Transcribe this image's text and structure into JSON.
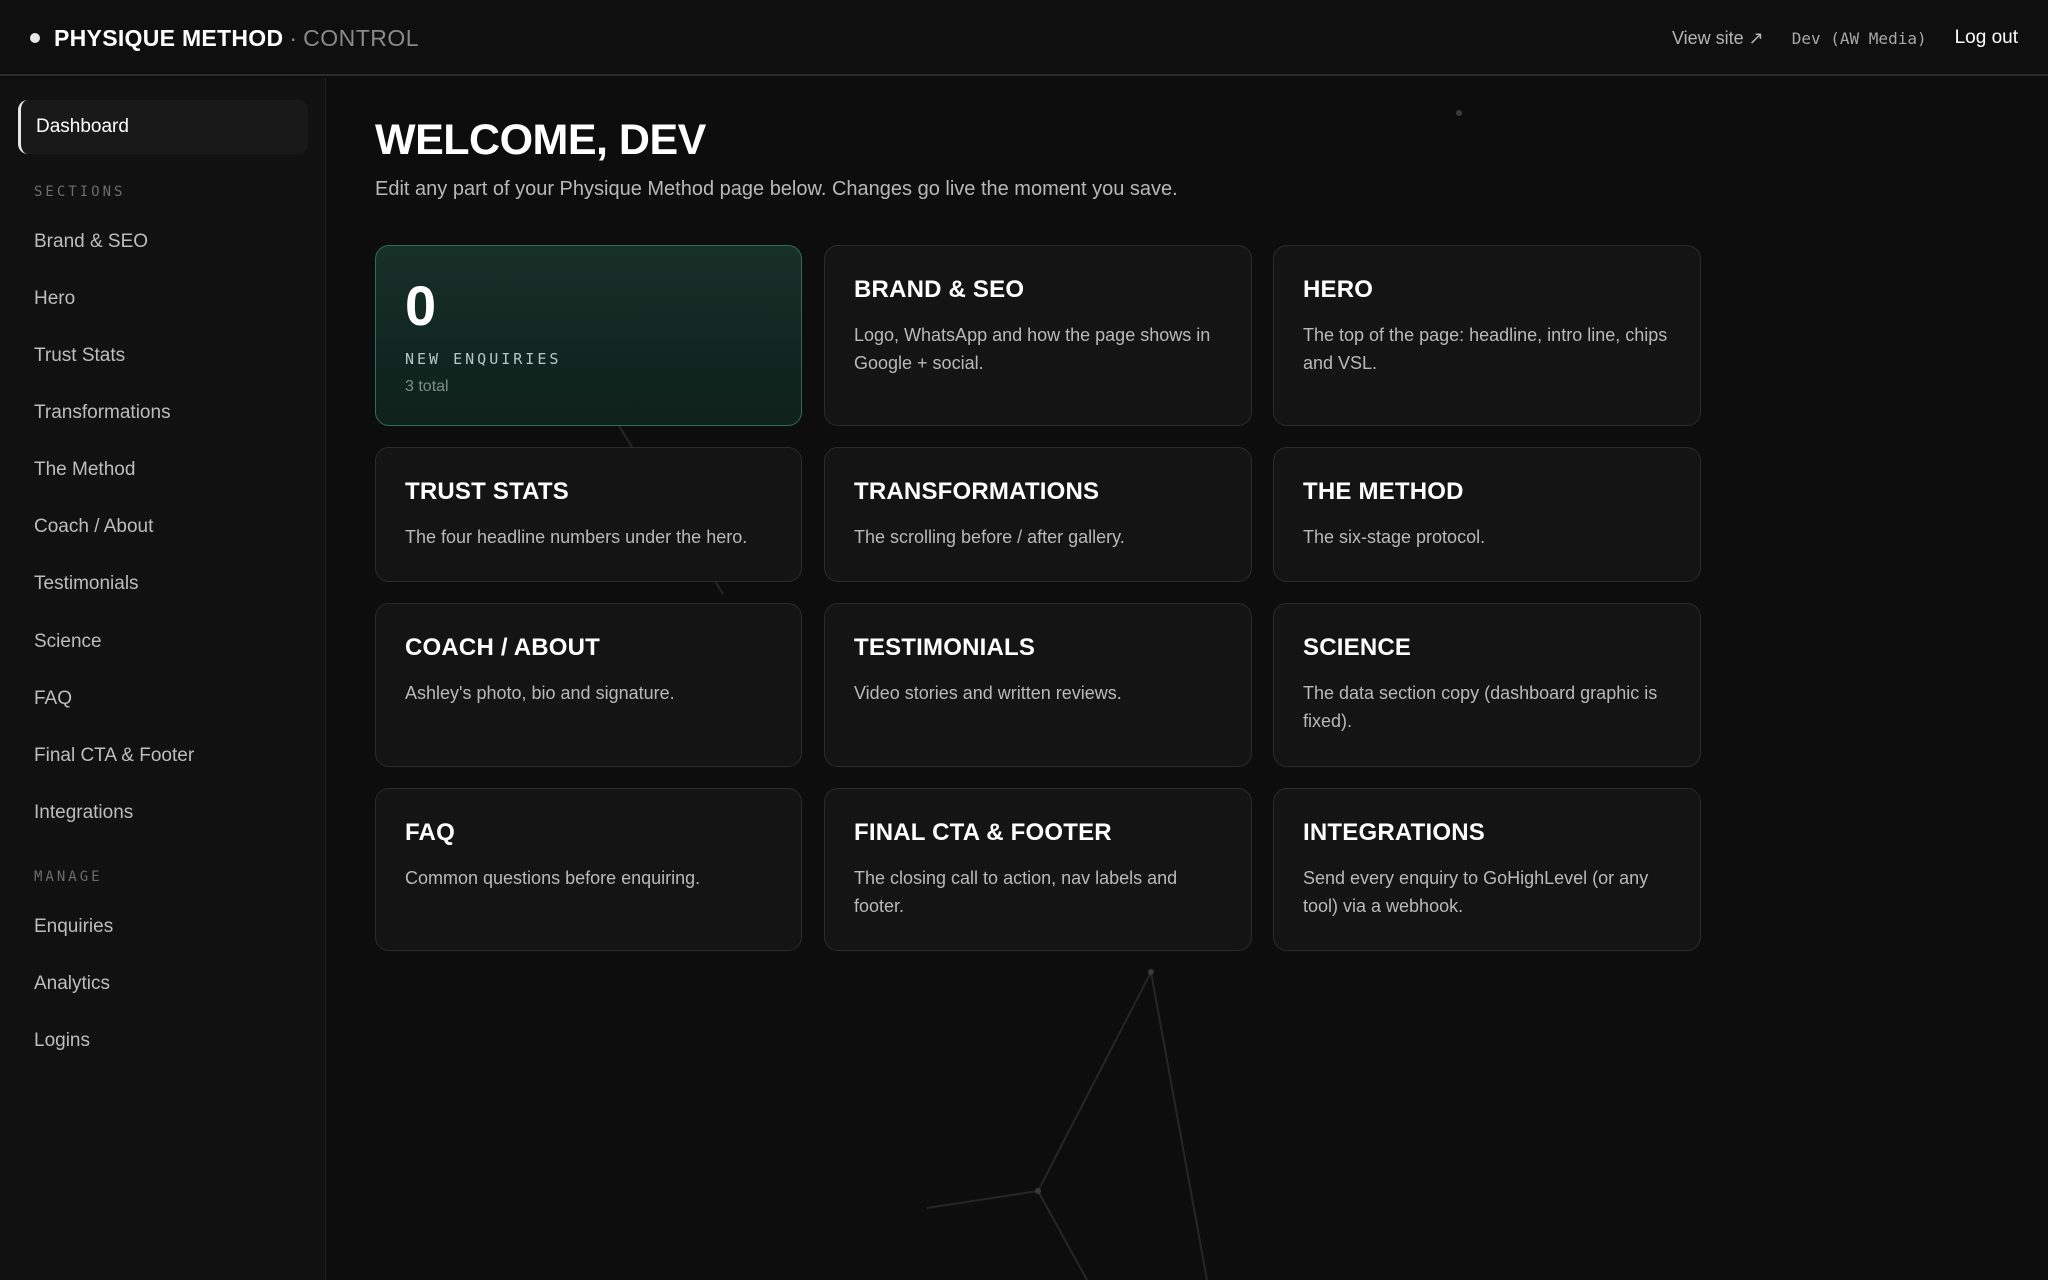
{
  "app": {
    "brand_name": "PHYSIQUE METHOD",
    "brand_sep": "·",
    "brand_sub": "CONTROL"
  },
  "topnav": {
    "view_site": "View site ↗",
    "user": "Dev (AW Media)",
    "logout": "Log out"
  },
  "sidebar": {
    "active": "Dashboard",
    "sections_heading": "SECTIONS",
    "sections": [
      "Brand & SEO",
      "Hero",
      "Trust Stats",
      "Transformations",
      "The Method",
      "Coach / About",
      "Testimonials",
      "Science",
      "FAQ",
      "Final CTA & Footer",
      "Integrations"
    ],
    "manage_heading": "MANAGE",
    "manage": [
      "Enquiries",
      "Analytics",
      "Logins"
    ]
  },
  "main": {
    "title": "WELCOME, DEV",
    "subtitle": "Edit any part of your Physique Method page below. Changes go live the moment you save.",
    "stat": {
      "value": "0",
      "label": "NEW ENQUIRIES",
      "total": "3 total"
    },
    "cards": [
      {
        "title": "BRAND & SEO",
        "desc": "Logo, WhatsApp and how the page shows in Google + social."
      },
      {
        "title": "HERO",
        "desc": "The top of the page: headline, intro line, chips and VSL."
      },
      {
        "title": "TRUST STATS",
        "desc": "The four headline numbers under the hero."
      },
      {
        "title": "TRANSFORMATIONS",
        "desc": "The scrolling before / after gallery."
      },
      {
        "title": "THE METHOD",
        "desc": "The six-stage protocol."
      },
      {
        "title": "COACH / ABOUT",
        "desc": "Ashley's photo, bio and signature."
      },
      {
        "title": "TESTIMONIALS",
        "desc": "Video stories and written reviews."
      },
      {
        "title": "SCIENCE",
        "desc": "The data section copy (dashboard graphic is fixed)."
      },
      {
        "title": "FAQ",
        "desc": "Common questions before enquiring."
      },
      {
        "title": "FINAL CTA & FOOTER",
        "desc": "The closing call to action, nav labels and footer."
      },
      {
        "title": "INTEGRATIONS",
        "desc": "Send every enquiry to GoHighLevel (or any tool) via a webhook."
      }
    ]
  },
  "colors": {
    "accent_border": "#2f6b57",
    "stat_bg": "#173028"
  }
}
